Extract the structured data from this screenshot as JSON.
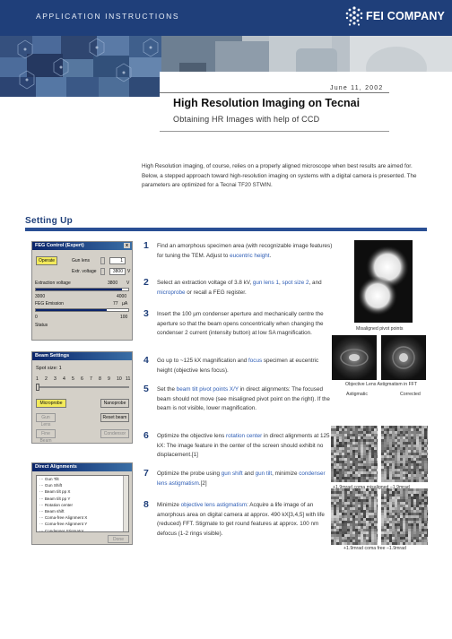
{
  "header": {
    "section_label": "APPLICATION INSTRUCTIONS",
    "logo_text": "FEI COMPANY",
    "date": "June 11, 2002",
    "title": "High Resolution Imaging on Tecnai",
    "subtitle": "Obtaining HR Images with help of CCD"
  },
  "intro": {
    "text": "High Resolution imaging, of course, relies on a properly aligned microscope when best results are aimed for. Below, a stepped approach toward high-resolution imaging on systems with a digital camera is presented. The parameters are optimized for a Tecnai TF20 STWIN."
  },
  "section": {
    "heading": "Setting Up"
  },
  "feg_panel": {
    "title": "FEG Control (Expert)",
    "close": "x",
    "operate_label": "Operate",
    "gun_lens_label": "Gun lens",
    "gun_lens_value": "1",
    "ext_voltage_label": "Extr. voltage",
    "ext_voltage_value": "3800",
    "ext_voltage_unit": "V",
    "extraction_label": "Extraction voltage",
    "extraction_value": "3800",
    "extraction_unit": "V",
    "extraction_fraction": 0.93,
    "scale1_min": "3000",
    "scale1_max": "4000",
    "emission_label": "FEG Emission",
    "emission_value": "77",
    "emission_unit": "µA",
    "emission_fraction": 0.77,
    "scale2_min": "0",
    "scale2_max": "100",
    "status_label": "Status"
  },
  "beam_panel": {
    "title": "Beam Settings",
    "spot_label": "Spot size: 1",
    "spot_ticks": [
      "1",
      "2",
      "3",
      "4",
      "5",
      "6",
      "7",
      "8",
      "9",
      "10",
      "11"
    ],
    "spot_value": 1,
    "microprobe": "Microprobe",
    "nanoprobe": "Nanoprobe",
    "reset_beam": "Reset beam",
    "disabled_1": "Gun Lens",
    "disabled_2": "Fine Beam",
    "disabled_3": "Condensor"
  },
  "align_panel": {
    "title": "Direct Alignments",
    "items": [
      "Gun Tilt",
      "Gun Shift",
      "Beam tilt pp X",
      "Beam tilt pp Y",
      "Rotation center",
      "Beam shift",
      "Coma-free Alignment X",
      "Coma-free Alignment Y",
      "Condenser Stigmator"
    ],
    "done_button": "Done"
  },
  "steps": [
    {
      "num": "1",
      "parts": [
        [
          "Find an amorphous specimen area (with recognizable image features) for tuning the TEM. Adjust to ",
          false
        ],
        [
          "eucentric height",
          true
        ],
        [
          ".",
          false
        ]
      ]
    },
    {
      "num": "2",
      "parts": [
        [
          "Select an extraction voltage of 3.8 kV, ",
          false
        ],
        [
          "gun lens 1",
          true
        ],
        [
          ", ",
          false
        ],
        [
          "spot size 2",
          true
        ],
        [
          ", and ",
          false
        ],
        [
          "microprobe",
          true
        ],
        [
          " or recall a FEG register.",
          false
        ]
      ]
    },
    {
      "num": "3",
      "parts": [
        [
          "Insert the 100 µm condenser aperture and mechanically centre the aperture so that the beam opens concentrically when changing the condenser 2 current (intensity button) at low SA magnification.",
          false
        ]
      ]
    },
    {
      "num": "4",
      "parts": [
        [
          "Go up to ~125 kX magnification and ",
          false
        ],
        [
          "focus",
          true
        ],
        [
          " specimen at eucentric height (objective lens focus).",
          false
        ]
      ]
    },
    {
      "num": "5",
      "parts": [
        [
          "Set the ",
          false
        ],
        [
          "beam tilt pivot points X/Y",
          true
        ],
        [
          " in direct alignments: The focused beam should not move (see misaligned pivot point on the right). If the beam is not visible, lower magnification.",
          false
        ]
      ]
    },
    {
      "num": "6",
      "parts": [
        [
          "Optimize the objective lens ",
          false
        ],
        [
          "rotation center",
          true
        ],
        [
          " in direct alignments at 125 kX: The image feature in the center of the screen should exhibit no displacement.[1]",
          false
        ]
      ]
    },
    {
      "num": "7",
      "parts": [
        [
          "Optimize the probe using ",
          false
        ],
        [
          "gun shift",
          true
        ],
        [
          " and ",
          false
        ],
        [
          "gun tilt",
          true
        ],
        [
          ", minimize ",
          false
        ],
        [
          "condenser lens astigmatism",
          true
        ],
        [
          ".[2]",
          false
        ]
      ]
    },
    {
      "num": "8",
      "parts": [
        [
          "Minimize ",
          false
        ],
        [
          "objective lens astigmatism",
          true
        ],
        [
          ": Acquire a life image of an amorphous area on digital camera at approx. 490 kX[3,4,5] with life (reduced) FFT. Stigmate to get round features at approx. 100 nm defocus (1-2 rings visible).",
          false
        ]
      ]
    }
  ],
  "figures": {
    "pivot_caption": "Misaligned pivot points",
    "astig_caption": "Objective Lens Astigmatism in FFT",
    "astig_label_left": "Astigmatic",
    "astig_label_right": "Corrected",
    "coma1_caption": "+1.9mrad coma misaligned –1.9mrad",
    "coma2_caption": "+1.9mrad coma free –1.9mrad"
  },
  "colors": {
    "brand_blue": "#1f3f7a",
    "rule_blue": "#2a4f94",
    "highlight_blue": "#2e5db5",
    "button_yellow": "#f3ea5b"
  }
}
